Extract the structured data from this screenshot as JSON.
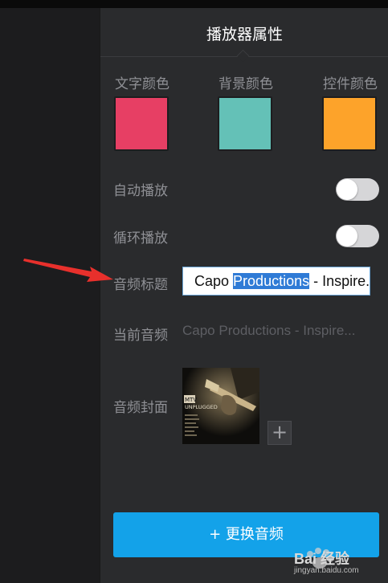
{
  "panel": {
    "title": "播放器属性"
  },
  "colors": {
    "text_label": "文字颜色",
    "background_label": "背景颜色",
    "control_label": "控件颜色",
    "text_color": "#e73f64",
    "background_color": "#64c1b7",
    "control_color": "#fda32a"
  },
  "settings": {
    "autoplay_label": "自动播放",
    "autoplay_on": false,
    "loop_label": "循环播放",
    "loop_on": false,
    "audio_title_label": "音频标题",
    "audio_title_value_before": "Capo ",
    "audio_title_value_selected": "Productions",
    "audio_title_value_after": " - Inspire.",
    "current_audio_label": "当前音频",
    "current_audio_value": "Capo Productions - Inspire...",
    "cover_label": "音频封面",
    "cover_album_text": "UNPLUGGED",
    "add_cover_symbol": "+"
  },
  "actions": {
    "replace_audio_label": "+ 更换音频"
  },
  "watermark": {
    "brand": "Bai 经验",
    "url": "jingyan.baidu.com"
  }
}
